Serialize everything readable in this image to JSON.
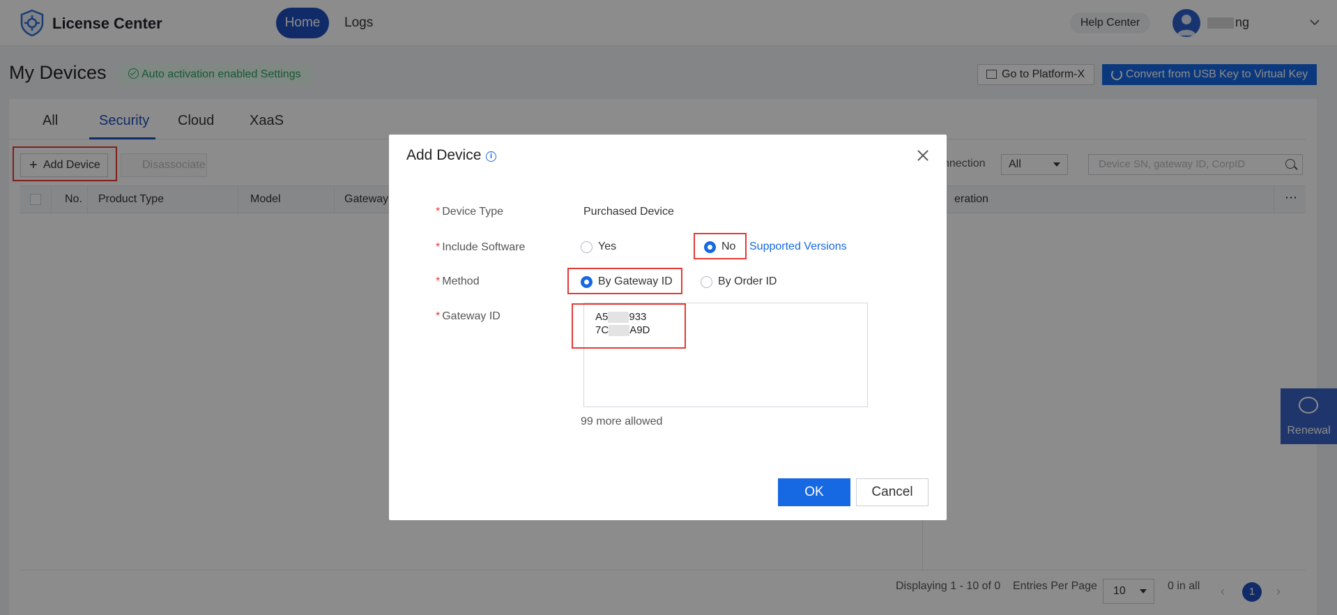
{
  "header": {
    "brand": "License Center",
    "nav": {
      "home": "Home",
      "logs": "Logs"
    },
    "help_center": "Help Center",
    "username_visible": "ng"
  },
  "page": {
    "title": "My Devices",
    "auto_activation": "Auto activation enabled Settings",
    "go_platform": "Go to Platform-X",
    "convert": "Convert from USB Key to Virtual Key"
  },
  "tabs": [
    "All",
    "Security",
    "Cloud",
    "XaaS"
  ],
  "toolbar": {
    "add_device": "Add Device",
    "disassociate": "Disassociate",
    "connection_label": "nnection",
    "connection_value": "All",
    "search_placeholder": "Device SN, gateway ID, CorpID"
  },
  "table": {
    "columns": [
      "No.",
      "Product Type",
      "Model",
      "Gateway",
      "eration"
    ],
    "more": "⋯"
  },
  "pagination": {
    "displaying": "Displaying 1 - 10 of 0",
    "entries_label": "Entries Per Page",
    "entries_value": "10",
    "total": "0 in all",
    "current_page": "1"
  },
  "renewal": "Renewal",
  "dialog": {
    "title": "Add Device",
    "info_glyph": "i",
    "fields": {
      "device_type": {
        "label": "Device Type",
        "value": "Purchased Device"
      },
      "include_software": {
        "label": "Include Software",
        "options": [
          "Yes",
          "No"
        ],
        "selected": "No",
        "link": "Supported Versions"
      },
      "method": {
        "label": "Method",
        "options": [
          "By Gateway ID",
          "By Order ID"
        ],
        "selected": "By Gateway ID"
      },
      "gateway_id": {
        "label": "Gateway ID",
        "line1_a": "A5",
        "line1_b": "933",
        "line2_a": "7C",
        "line2_b": "A9D",
        "allowed": "99 more allowed"
      }
    },
    "ok": "OK",
    "cancel": "Cancel"
  },
  "colors": {
    "primary": "#1668e3",
    "nav_active": "#1f4fbf",
    "highlight": "#e53935",
    "success": "#27a35c"
  }
}
